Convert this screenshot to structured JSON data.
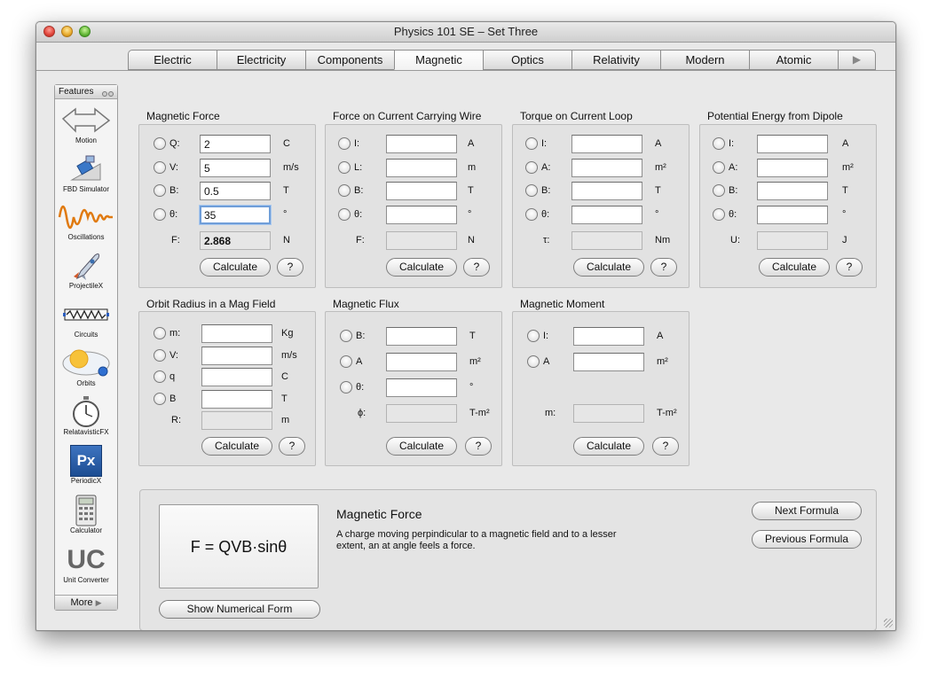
{
  "window": {
    "title": "Physics 101 SE – Set Three"
  },
  "tabs": [
    "Electric",
    "Electricity",
    "Components",
    "Magnetic",
    "Optics",
    "Relativity",
    "Modern",
    "Atomic"
  ],
  "active_tab": "Magnetic",
  "sidebar": {
    "header": "Features",
    "items": [
      {
        "label": "Motion",
        "icon": "motion-arrows-icon"
      },
      {
        "label": "FBD Simulator",
        "icon": "fbd-simulator-icon"
      },
      {
        "label": "Oscillations",
        "icon": "oscillations-wave-icon"
      },
      {
        "label": "ProjectileX",
        "icon": "rocket-icon"
      },
      {
        "label": "Circuits",
        "icon": "resistor-icon"
      },
      {
        "label": "Orbits",
        "icon": "orbits-icon"
      },
      {
        "label": "RelatavisticFX",
        "icon": "stopwatch-icon"
      },
      {
        "label": "PeriodicX",
        "icon": "periodic-px-icon",
        "glyph": "Px"
      },
      {
        "label": "Calculator",
        "icon": "calculator-icon"
      },
      {
        "label": "Unit Converter",
        "icon": "unit-converter-icon",
        "glyph": "UC"
      }
    ],
    "more": "More"
  },
  "boxes": {
    "magforce": {
      "title": "Magnetic Force",
      "rows": [
        {
          "label": "Q:",
          "value": "2",
          "unit": "C"
        },
        {
          "label": "V:",
          "value": "5",
          "unit": "m/s"
        },
        {
          "label": "B:",
          "value": "0.5",
          "unit": "T"
        },
        {
          "label": "θ:",
          "value": "35",
          "unit": "°"
        }
      ],
      "result": {
        "label": "F:",
        "value": "2.868",
        "unit": "N"
      }
    },
    "wire": {
      "title": "Force on Current Carrying Wire",
      "rows": [
        {
          "label": "I:",
          "value": "",
          "unit": "A"
        },
        {
          "label": "L:",
          "value": "",
          "unit": "m"
        },
        {
          "label": "B:",
          "value": "",
          "unit": "T"
        },
        {
          "label": "θ:",
          "value": "",
          "unit": "°"
        }
      ],
      "result": {
        "label": "F:",
        "value": "",
        "unit": "N"
      }
    },
    "torque": {
      "title": "Torque on Current Loop",
      "rows": [
        {
          "label": "I:",
          "value": "",
          "unit": "A"
        },
        {
          "label": "A:",
          "value": "",
          "unit": "m²"
        },
        {
          "label": "B:",
          "value": "",
          "unit": "T"
        },
        {
          "label": "θ:",
          "value": "",
          "unit": "°"
        }
      ],
      "result": {
        "label": "τ:",
        "value": "",
        "unit": "Nm"
      }
    },
    "dipole": {
      "title": "Potential Energy from Dipole",
      "rows": [
        {
          "label": "I:",
          "value": "",
          "unit": "A"
        },
        {
          "label": "A:",
          "value": "",
          "unit": "m²"
        },
        {
          "label": "B:",
          "value": "",
          "unit": "T"
        },
        {
          "label": "θ:",
          "value": "",
          "unit": "°"
        }
      ],
      "result": {
        "label": "U:",
        "value": "",
        "unit": "J"
      }
    },
    "orbit": {
      "title": "Orbit Radius in a Mag Field",
      "rows": [
        {
          "label": "m:",
          "value": "",
          "unit": "Kg"
        },
        {
          "label": "V:",
          "value": "",
          "unit": "m/s"
        },
        {
          "label": "q",
          "value": "",
          "unit": "C"
        },
        {
          "label": "B",
          "value": "",
          "unit": "T"
        }
      ],
      "result": {
        "label": "R:",
        "value": "",
        "unit": "m"
      }
    },
    "flux": {
      "title": "Magnetic Flux",
      "rows": [
        {
          "label": "B:",
          "value": "",
          "unit": "T"
        },
        {
          "label": "A",
          "value": "",
          "unit": "m²"
        },
        {
          "label": "θ:",
          "value": "",
          "unit": "°"
        }
      ],
      "result": {
        "label": "ϕ:",
        "value": "",
        "unit": "T-m²"
      }
    },
    "moment": {
      "title": "Magnetic Moment",
      "rows": [
        {
          "label": "I:",
          "value": "",
          "unit": "A"
        },
        {
          "label": "A",
          "value": "",
          "unit": "m²"
        }
      ],
      "result": {
        "label": "m:",
        "value": "",
        "unit": "T-m²"
      }
    }
  },
  "buttons": {
    "calculate": "Calculate",
    "help": "?"
  },
  "formula": {
    "expression": "F = QVB·sinθ",
    "title": "Magnetic Force",
    "description": "A charge moving perpindicular to a magnetic field and to a lesser extent, an at angle feels a force.",
    "show_numerical": "Show Numerical Form",
    "next": "Next Formula",
    "previous": "Previous Formula"
  }
}
